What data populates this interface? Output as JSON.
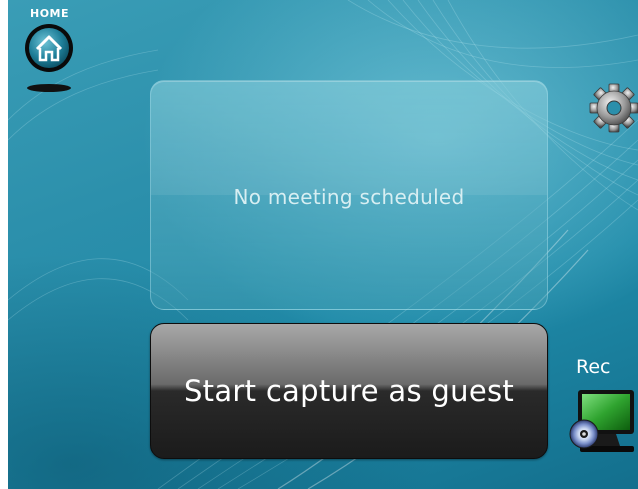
{
  "header": {
    "home_label": "HOME",
    "home_icon": "home-icon",
    "settings_icon": "gear-icon"
  },
  "meeting": {
    "status_text": "No meeting scheduled"
  },
  "actions": {
    "capture_label": "Start capture as guest",
    "rec_label": "Rec",
    "rec_icon": "monitor-disc-icon"
  },
  "colors": {
    "background": "#2b8fab",
    "panel_text": "#d7eef2",
    "button_dark": "#1b1b1b",
    "monitor_screen": "#2fa32f"
  }
}
